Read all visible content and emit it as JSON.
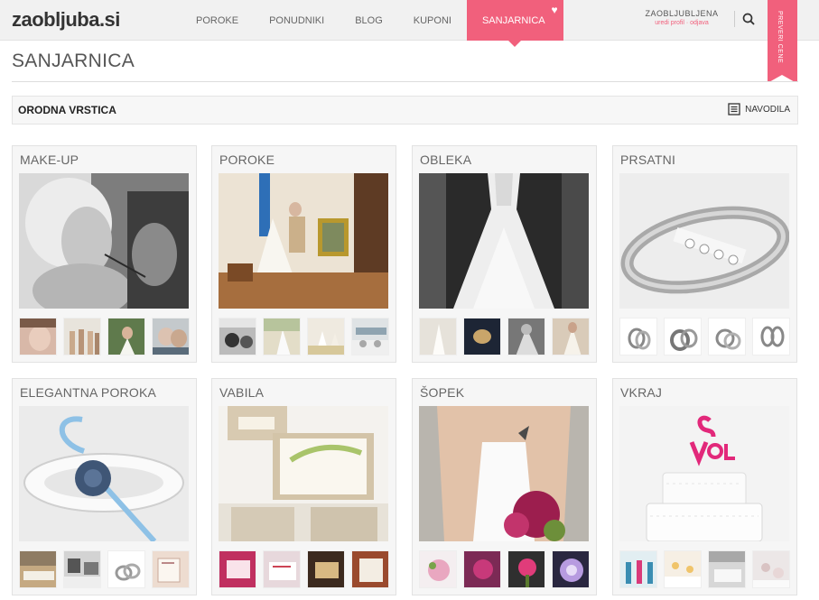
{
  "header": {
    "logo": "zaobljuba.si",
    "nav": [
      "POROKE",
      "PONUDNIKI",
      "BLOG",
      "KUPONI",
      "SANJARNICA"
    ],
    "active_nav": "SANJARNICA",
    "user_name": "ZAOBLJUBLJENA",
    "user_links": "uredi profil · odjava",
    "ribbon": "PREVERI CENE",
    "accent_color": "#f1607c"
  },
  "page": {
    "title": "SANJARNICA",
    "toolbar_title": "ORODNA VRSTICA",
    "guide_label": "NAVODILA"
  },
  "cards": [
    {
      "title": "MAKE-UP"
    },
    {
      "title": "POROKE"
    },
    {
      "title": "OBLEKA"
    },
    {
      "title": "PRSATNI"
    },
    {
      "title": "ELEGANTNA POROKA"
    },
    {
      "title": "VABILA"
    },
    {
      "title": "ŠOPEK"
    },
    {
      "title": "VKRAJ"
    }
  ],
  "icons": {
    "search": "search-icon",
    "guide": "document-icon",
    "heart": "heart-icon"
  }
}
